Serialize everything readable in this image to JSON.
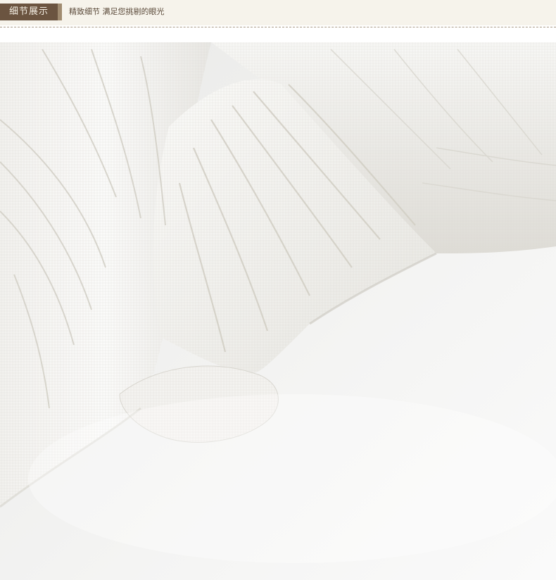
{
  "header": {
    "section_title": "细节展示",
    "subtitle": "精致细节 满足您挑剔的眼光",
    "colors": {
      "tag_background": "#6b5440",
      "header_background": "#f6f3eb",
      "divider": "#a89a86"
    }
  },
  "photo": {
    "subject": "close-up of white sheer curtain fabric with vertical stripe texture"
  }
}
